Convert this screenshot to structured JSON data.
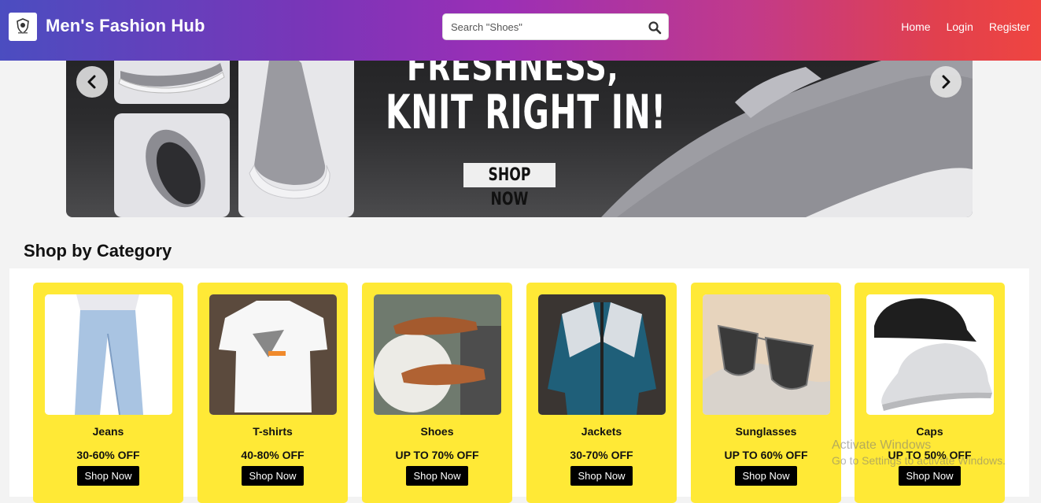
{
  "navbar": {
    "brand": "Men's Fashion Hub",
    "logo_icon": "shield-crest-icon",
    "search": {
      "placeholder": "Search \"Shoes\"",
      "icon": "search-icon"
    },
    "links": [
      "Home",
      "Login",
      "Register"
    ]
  },
  "banner": {
    "headline_line1": "FRESHNESS,",
    "headline_line2": "KNIT RIGHT IN!",
    "cta": "SHOP NOW",
    "prev_icon": "chevron-left-icon",
    "next_icon": "chevron-right-icon"
  },
  "categories_section": {
    "title": "Shop by Category",
    "card_color": "#ffe936",
    "items": [
      {
        "name": "Jeans",
        "offer": "30-60% OFF",
        "button": "Shop Now"
      },
      {
        "name": "T-shirts",
        "offer": "40-80% OFF",
        "button": "Shop Now"
      },
      {
        "name": "Shoes",
        "offer": "UP TO 70% OFF",
        "button": "Shop Now"
      },
      {
        "name": "Jackets",
        "offer": "30-70% OFF",
        "button": "Shop Now"
      },
      {
        "name": "Sunglasses",
        "offer": "UP TO 60% OFF",
        "button": "Shop Now"
      },
      {
        "name": "Caps",
        "offer": "UP TO 50% OFF",
        "button": "Shop Now"
      }
    ]
  },
  "watermark": {
    "line1": "Activate Windows",
    "line2": "Go to Settings to activate Windows."
  }
}
